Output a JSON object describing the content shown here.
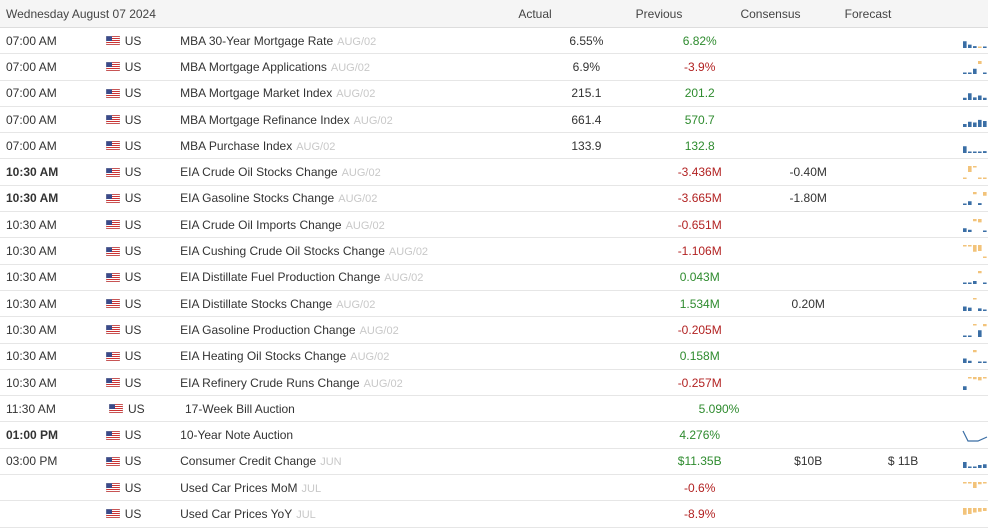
{
  "header": {
    "date": "Wednesday August 07 2024",
    "col_actual": "Actual",
    "col_previous": "Previous",
    "col_consensus": "Consensus",
    "col_forecast": "Forecast"
  },
  "colors": {
    "positive": "#2e8b2e",
    "negative": "#b22222",
    "spark_blue": "#3a6ea5",
    "spark_tan": "#f2c37a"
  },
  "rows": [
    {
      "time": "07:00 AM",
      "bold": false,
      "country": "US",
      "event": "MBA 30-Year Mortgage Rate",
      "ref": "AUG/02",
      "actual": "6.55%",
      "previous": "6.82%",
      "prev_tone": "pos",
      "consensus": "",
      "forecast": "",
      "spark": [
        [
          0.9,
          "b"
        ],
        [
          0.45,
          "b"
        ],
        [
          0.25,
          "b"
        ],
        [
          0.1,
          "t"
        ],
        [
          0.1,
          "b"
        ]
      ]
    },
    {
      "time": "07:00 AM",
      "bold": false,
      "country": "US",
      "event": "MBA Mortgage Applications",
      "ref": "AUG/02",
      "actual": "6.9%",
      "previous": "-3.9%",
      "prev_tone": "neg",
      "consensus": "",
      "forecast": "",
      "spark": [
        [
          0.1,
          "b"
        ],
        [
          0.1,
          "b"
        ],
        [
          0.7,
          "b"
        ],
        [
          -0.4,
          "t"
        ],
        [
          0.2,
          "b"
        ]
      ]
    },
    {
      "time": "07:00 AM",
      "bold": false,
      "country": "US",
      "event": "MBA Mortgage Market Index",
      "ref": "AUG/02",
      "actual": "215.1",
      "previous": "201.2",
      "prev_tone": "pos",
      "consensus": "",
      "forecast": "",
      "spark": [
        [
          0.3,
          "b"
        ],
        [
          0.9,
          "b"
        ],
        [
          0.35,
          "b"
        ],
        [
          0.6,
          "b"
        ],
        [
          0.3,
          "b"
        ]
      ]
    },
    {
      "time": "07:00 AM",
      "bold": false,
      "country": "US",
      "event": "MBA Mortgage Refinance Index",
      "ref": "AUG/02",
      "actual": "661.4",
      "previous": "570.7",
      "prev_tone": "pos",
      "consensus": "",
      "forecast": "",
      "spark": [
        [
          0.4,
          "b"
        ],
        [
          0.7,
          "b"
        ],
        [
          0.6,
          "b"
        ],
        [
          0.95,
          "b"
        ],
        [
          0.8,
          "b"
        ]
      ]
    },
    {
      "time": "07:00 AM",
      "bold": false,
      "country": "US",
      "event": "MBA Purchase Index",
      "ref": "AUG/02",
      "actual": "133.9",
      "previous": "132.8",
      "prev_tone": "pos",
      "consensus": "",
      "forecast": "",
      "spark": [
        [
          0.9,
          "b"
        ],
        [
          0.1,
          "b"
        ],
        [
          0.1,
          "b"
        ],
        [
          0.1,
          "b"
        ],
        [
          0.25,
          "b"
        ]
      ]
    },
    {
      "time": "10:30 AM",
      "bold": true,
      "country": "US",
      "event": "EIA Crude Oil Stocks Change",
      "ref": "AUG/02",
      "actual": "",
      "previous": "-3.436M",
      "prev_tone": "neg",
      "consensus": "-0.40M",
      "forecast": "",
      "spark": [
        [
          0.1,
          "t"
        ],
        [
          -0.8,
          "t"
        ],
        [
          -0.2,
          "t"
        ],
        [
          0,
          "t"
        ],
        [
          0,
          "t"
        ]
      ]
    },
    {
      "time": "10:30 AM",
      "bold": true,
      "country": "US",
      "event": "EIA Gasoline Stocks Change",
      "ref": "AUG/02",
      "actual": "",
      "previous": "-3.665M",
      "prev_tone": "neg",
      "consensus": "-1.80M",
      "forecast": "",
      "spark": [
        [
          0.1,
          "b"
        ],
        [
          0.5,
          "b"
        ],
        [
          -0.3,
          "t"
        ],
        [
          0.25,
          "b"
        ],
        [
          -0.5,
          "t"
        ]
      ]
    },
    {
      "time": "10:30 AM",
      "bold": false,
      "country": "US",
      "event": "EIA Crude Oil Imports Change",
      "ref": "AUG/02",
      "actual": "",
      "previous": "-0.651M",
      "prev_tone": "neg",
      "consensus": "",
      "forecast": "",
      "spark": [
        [
          0.5,
          "b"
        ],
        [
          0.3,
          "b"
        ],
        [
          -0.3,
          "t"
        ],
        [
          -0.45,
          "t"
        ],
        [
          0.1,
          "b"
        ]
      ]
    },
    {
      "time": "10:30 AM",
      "bold": false,
      "country": "US",
      "event": "EIA Cushing Crude Oil Stocks Change",
      "ref": "AUG/02",
      "actual": "",
      "previous": "-1.106M",
      "prev_tone": "neg",
      "consensus": "",
      "forecast": "",
      "spark": [
        [
          -0.1,
          "t"
        ],
        [
          -0.2,
          "t"
        ],
        [
          -0.9,
          "t"
        ],
        [
          -0.8,
          "t"
        ],
        [
          0,
          "t"
        ]
      ]
    },
    {
      "time": "10:30 AM",
      "bold": false,
      "country": "US",
      "event": "EIA Distillate Fuel Production Change",
      "ref": "AUG/02",
      "actual": "",
      "previous": "0.043M",
      "prev_tone": "pos",
      "consensus": "",
      "forecast": "",
      "spark": [
        [
          0.05,
          "b"
        ],
        [
          0.1,
          "b"
        ],
        [
          0.4,
          "b"
        ],
        [
          -0.3,
          "t"
        ],
        [
          0.1,
          "b"
        ]
      ]
    },
    {
      "time": "10:30 AM",
      "bold": false,
      "country": "US",
      "event": "EIA Distillate Stocks Change",
      "ref": "AUG/02",
      "actual": "",
      "previous": "1.534M",
      "prev_tone": "pos",
      "consensus": "0.20M",
      "forecast": "",
      "spark": [
        [
          0.6,
          "b"
        ],
        [
          0.45,
          "b"
        ],
        [
          -0.2,
          "t"
        ],
        [
          0.35,
          "b"
        ],
        [
          0.1,
          "b"
        ]
      ]
    },
    {
      "time": "10:30 AM",
      "bold": false,
      "country": "US",
      "event": "EIA Gasoline Production Change",
      "ref": "AUG/02",
      "actual": "",
      "previous": "-0.205M",
      "prev_tone": "neg",
      "consensus": "",
      "forecast": "",
      "spark": [
        [
          0.1,
          "b"
        ],
        [
          0.2,
          "b"
        ],
        [
          -0.2,
          "t"
        ],
        [
          0.9,
          "b"
        ],
        [
          -0.3,
          "t"
        ]
      ]
    },
    {
      "time": "10:30 AM",
      "bold": false,
      "country": "US",
      "event": "EIA Heating Oil Stocks Change",
      "ref": "AUG/02",
      "actual": "",
      "previous": "0.158M",
      "prev_tone": "pos",
      "consensus": "",
      "forecast": "",
      "spark": [
        [
          0.6,
          "b"
        ],
        [
          0.3,
          "b"
        ],
        [
          -0.3,
          "t"
        ],
        [
          0.2,
          "b"
        ],
        [
          0.1,
          "b"
        ]
      ]
    },
    {
      "time": "10:30 AM",
      "bold": false,
      "country": "US",
      "event": "EIA Refinery Crude Runs Change",
      "ref": "AUG/02",
      "actual": "",
      "previous": "-0.257M",
      "prev_tone": "neg",
      "consensus": "",
      "forecast": "",
      "spark": [
        [
          0.5,
          "b"
        ],
        [
          -0.2,
          "t"
        ],
        [
          -0.3,
          "t"
        ],
        [
          -0.45,
          "t"
        ],
        [
          -0.2,
          "t"
        ]
      ]
    },
    {
      "time": "11:30 AM",
      "bold": false,
      "country": "US",
      "event": "17-Week Bill Auction",
      "ref": "",
      "actual": "",
      "previous": "5.090%",
      "prev_tone": "pos",
      "consensus": "",
      "forecast": "",
      "spark": []
    },
    {
      "time": "01:00 PM",
      "bold": true,
      "country": "US",
      "event": "10-Year Note Auction",
      "ref": "",
      "actual": "",
      "previous": "4.276%",
      "prev_tone": "pos",
      "consensus": "",
      "forecast": "",
      "spark": "line"
    },
    {
      "time": "03:00 PM",
      "bold": false,
      "country": "US",
      "event": "Consumer Credit Change",
      "ref": "JUN",
      "actual": "",
      "previous": "$11.35B",
      "prev_tone": "pos",
      "consensus": "$10B",
      "forecast": "$ 11B",
      "spark": [
        [
          0.8,
          "b"
        ],
        [
          0.1,
          "b"
        ],
        [
          0.1,
          "b"
        ],
        [
          0.4,
          "b"
        ],
        [
          0.5,
          "b"
        ]
      ]
    },
    {
      "time": "",
      "bold": false,
      "country": "US",
      "event": "Used Car Prices MoM",
      "ref": "JUL",
      "actual": "",
      "previous": "-0.6%",
      "prev_tone": "neg",
      "consensus": "",
      "forecast": "",
      "spark": [
        [
          -0.1,
          "t"
        ],
        [
          -0.1,
          "t"
        ],
        [
          -0.8,
          "t"
        ],
        [
          -0.3,
          "t"
        ],
        [
          -0.1,
          "t"
        ]
      ]
    },
    {
      "time": "",
      "bold": false,
      "country": "US",
      "event": "Used Car Prices YoY",
      "ref": "JUL",
      "actual": "",
      "previous": "-8.9%",
      "prev_tone": "neg",
      "consensus": "",
      "forecast": "",
      "spark": [
        [
          -0.9,
          "t"
        ],
        [
          -0.8,
          "t"
        ],
        [
          -0.6,
          "t"
        ],
        [
          -0.5,
          "t"
        ],
        [
          -0.4,
          "t"
        ]
      ]
    }
  ]
}
